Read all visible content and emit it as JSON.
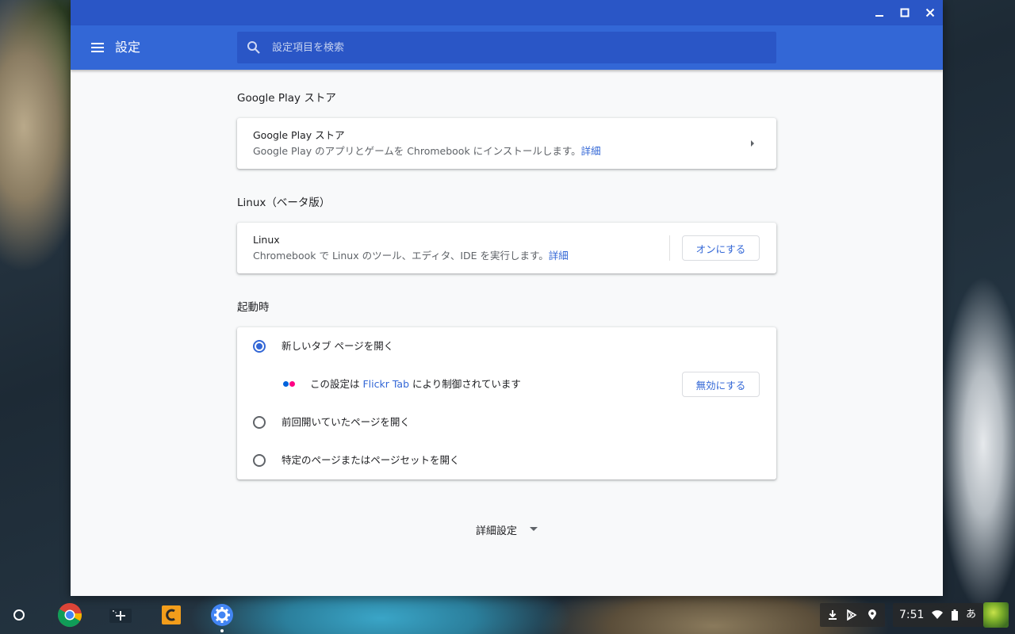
{
  "window": {
    "app_title": "設定",
    "search_placeholder": "設定項目を検索"
  },
  "sections": {
    "play": {
      "title": "Google Play ストア",
      "card_title": "Google Play ストア",
      "card_desc": "Google Play のアプリとゲームを Chromebook にインストールします。",
      "link": "詳細"
    },
    "linux": {
      "title": "Linux（ベータ版）",
      "card_title": "Linux",
      "card_desc": "Chromebook で Linux のツール、エディタ、IDE を実行します。",
      "link": "詳細",
      "button": "オンにする"
    },
    "startup": {
      "title": "起動時",
      "options": [
        {
          "label": "新しいタブ ページを開く",
          "checked": true
        },
        {
          "label": "前回開いていたページを開く",
          "checked": false
        },
        {
          "label": "特定のページまたはページセットを開く",
          "checked": false
        }
      ],
      "extension": {
        "prefix": "この設定は ",
        "name": "Flickr Tab",
        "suffix": " により制御されています",
        "button": "無効にする"
      }
    },
    "advanced": {
      "label": "詳細設定"
    }
  },
  "shelf": {
    "apps": [
      "launcher-icon",
      "chrome-icon",
      "add-app-icon",
      "c-app-icon",
      "settings-app-icon"
    ],
    "tray": {
      "time": "7:51",
      "ime": "あ"
    }
  },
  "colors": {
    "titlebar": "#2a56c6",
    "toolbar": "#3367d6",
    "accent": "#3367d6",
    "background": "#f8f9fa"
  }
}
